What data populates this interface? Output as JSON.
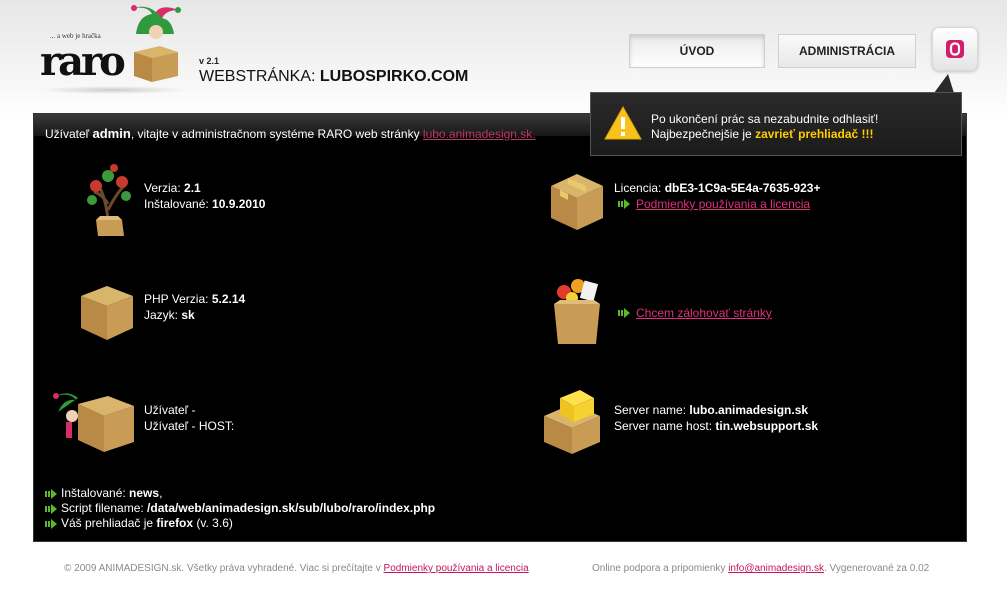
{
  "logo": {
    "tagline": "... a web je hračka",
    "word": "raro"
  },
  "header": {
    "version": "v 2.1",
    "title_prefix": "WEBSTRÁNKA: ",
    "title_site": "LUBOSPIRKO.COM"
  },
  "nav": {
    "uvod": "ÚVOD",
    "admin": "ADMINISTRÁCIA"
  },
  "tooltip": {
    "line1": "Po ukončení prác sa nezabudnite odhlasiť!",
    "line2_prefix": "Najbezpečnejšie je ",
    "line2_highlight": "zavrieť prehliadač !!!"
  },
  "welcome": {
    "prefix": "Užívateľ ",
    "user": "admin",
    "middle": ", vitajte v administračnom systéme RARO web stránky ",
    "link": "lubo.animadesign.sk."
  },
  "version_block": {
    "version_label": "Verzia: ",
    "version_value": "2.1",
    "installed_label": "Inštalované: ",
    "installed_value": "10.9.2010"
  },
  "license_block": {
    "label": "Licencia: ",
    "value": "dbE3-1C9a-5E4a-7635-923+",
    "link": "Podmienky používania a licencia"
  },
  "php_block": {
    "php_label": "PHP Verzia: ",
    "php_value": "5.2.14",
    "lang_label": "Jazyk: ",
    "lang_value": "sk"
  },
  "backup_block": {
    "link": "Chcem zálohovať stránky"
  },
  "user_block": {
    "line1": "Užívateľ -",
    "line2": "Užívateľ - HOST:"
  },
  "server_block": {
    "name_label": "Server name: ",
    "name_value": "lubo.animadesign.sk",
    "host_label": "Server name host: ",
    "host_value": "tin.websupport.sk"
  },
  "bottom_info": {
    "installed_label": "Inštalované: ",
    "installed_value": "news",
    "installed_suffix": ",",
    "script_label": "Script filename: ",
    "script_value": "/data/web/animadesign.sk/sub/lubo/raro/index.php",
    "browser_label": "Váš prehliadač je ",
    "browser_value": "firefox",
    "browser_suffix": " (v. 3.6)"
  },
  "footer": {
    "left_text": "© 2009 ANIMADESIGN.sk. Všetky práva vyhradené. Viac si prečítajte v ",
    "left_link": "Podmienky používania a licencia",
    "right_text": "Online podpora a pripomienky ",
    "right_link": "info@animadesign.sk",
    "right_suffix": ". Vygenerované za 0.02"
  },
  "icons": {
    "logo": "jester-box-icon",
    "power": "power-icon",
    "warning": "warning-icon",
    "tree": "tree-box-icon",
    "license": "sealed-box-icon",
    "php": "cardboard-box-icon",
    "backup": "open-box-icon",
    "user": "jester-box-icon",
    "server": "yellow-box-icon",
    "arrow": "green-arrow-icon"
  },
  "colors": {
    "link": "#e0317a",
    "highlight": "#ffcc00",
    "panel": "#000000"
  }
}
